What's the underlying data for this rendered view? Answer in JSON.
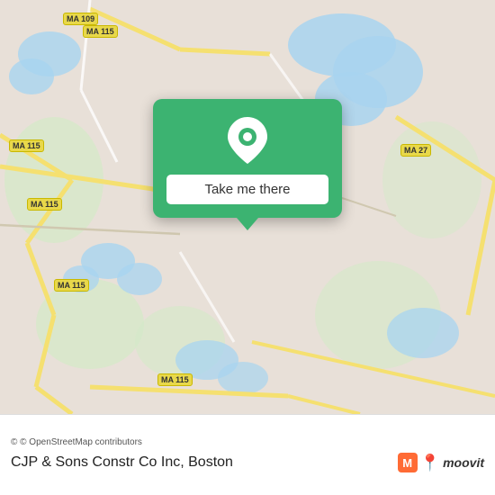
{
  "map": {
    "attribution": "© OpenStreetMap contributors",
    "background_color": "#e8e0d8"
  },
  "popup": {
    "button_label": "Take me there",
    "pin_icon": "map-pin"
  },
  "bottom_bar": {
    "place_name": "CJP & Sons Constr Co Inc, Boston",
    "moovit_logo_text": "moovit"
  },
  "road_labels": [
    "MA 115",
    "MA 115",
    "MA 115",
    "MA 115",
    "MA 115",
    "MA 109",
    "MA 27"
  ]
}
